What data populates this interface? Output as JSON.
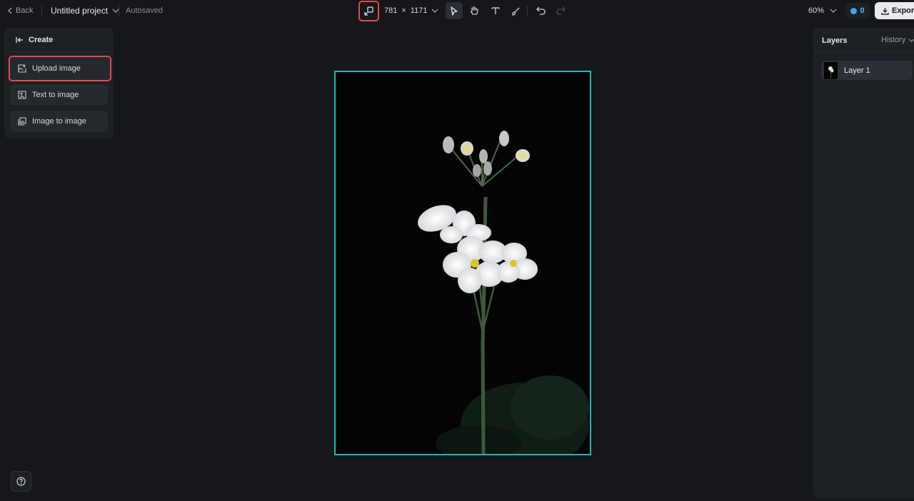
{
  "topbar": {
    "back_label": "Back",
    "project_name": "Untitled project",
    "autosave_status": "Autosaved",
    "canvas_width": "781",
    "canvas_times": "×",
    "canvas_height": "1171",
    "zoom": "60%",
    "credits": "0",
    "export_label": "Export"
  },
  "create_panel": {
    "title": "Create",
    "items": [
      {
        "label": "Upload image",
        "icon": "upload-image-icon"
      },
      {
        "label": "Text to image",
        "icon": "text-to-image-icon"
      },
      {
        "label": "Image to image",
        "icon": "image-to-image-icon"
      }
    ]
  },
  "layers_panel": {
    "title": "Layers",
    "history_label": "History",
    "layers": [
      {
        "name": "Layer 1"
      }
    ]
  },
  "colors": {
    "accent_frame": "#1fb7b7",
    "highlight": "#e5484d",
    "credit_blue": "#3aa7e8"
  }
}
